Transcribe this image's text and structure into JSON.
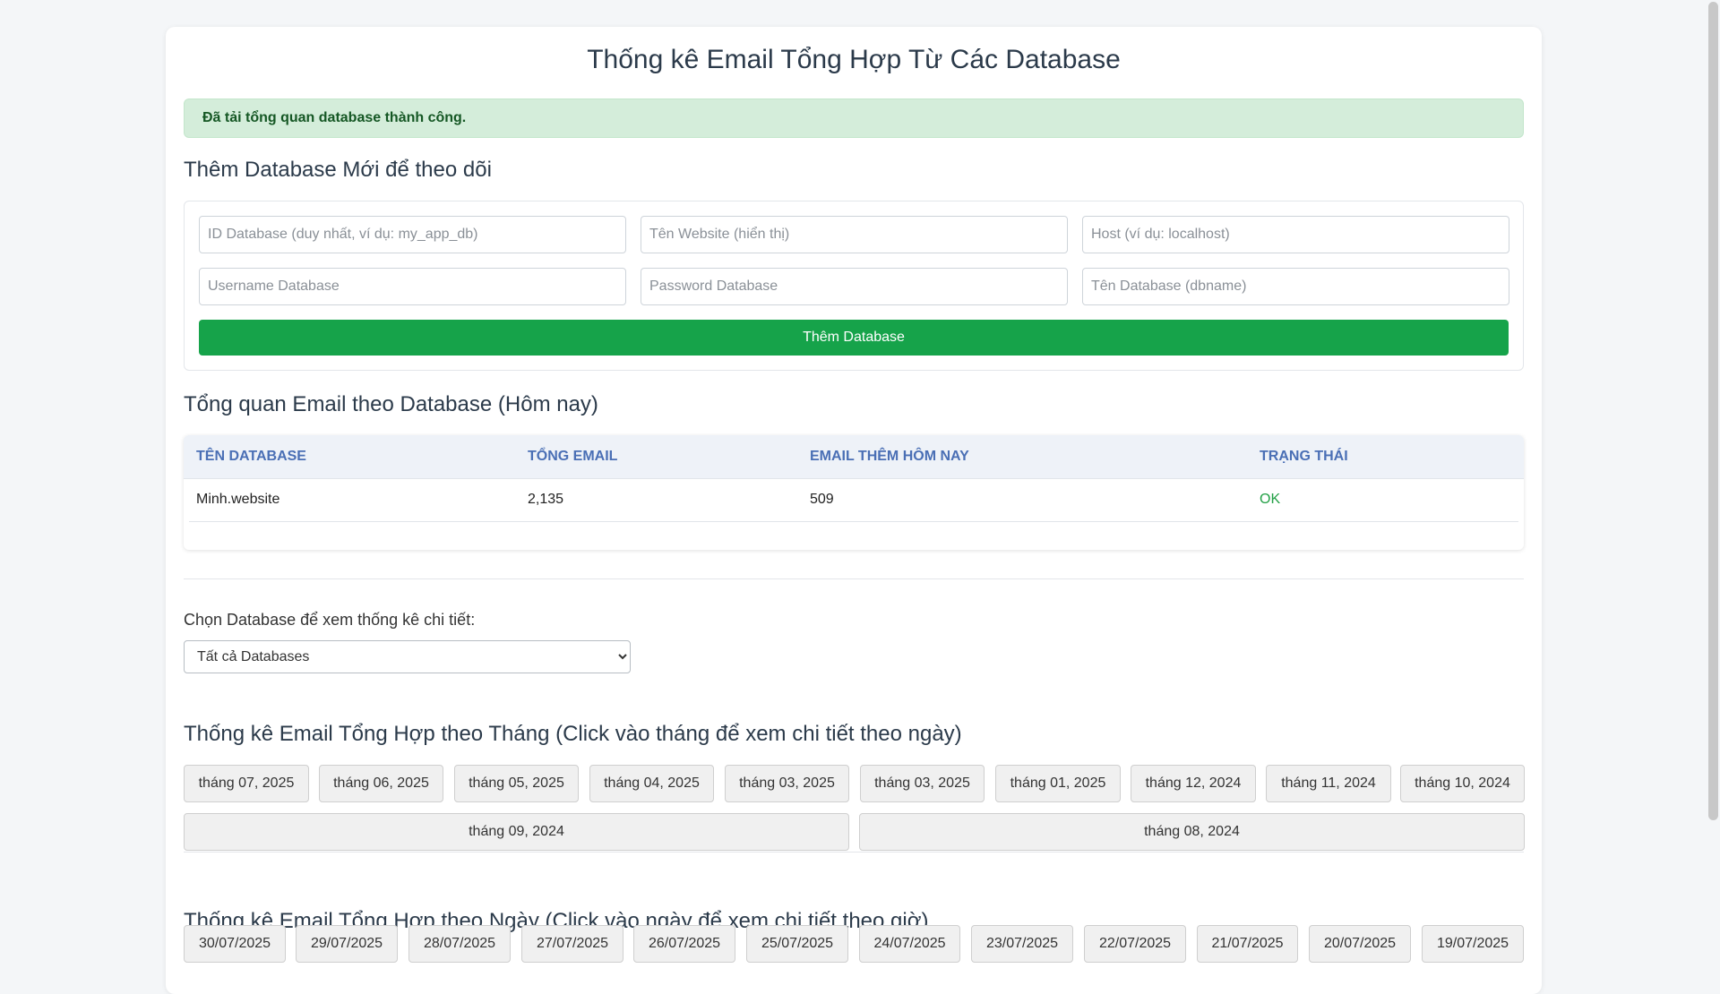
{
  "page": {
    "title": "Thống kê Email Tổng Hợp Từ Các Database"
  },
  "alert": {
    "message": "Đã tải tổng quan database thành công."
  },
  "add_form": {
    "heading": "Thêm Database Mới để theo dõi",
    "fields": [
      {
        "placeholder": "ID Database (duy nhất, ví dụ: my_app_db)",
        "value": ""
      },
      {
        "placeholder": "Tên Website (hiển thị)",
        "value": ""
      },
      {
        "placeholder": "Host (ví dụ: localhost)",
        "value": ""
      },
      {
        "placeholder": "Username Database",
        "value": ""
      },
      {
        "placeholder": "Password Database",
        "value": ""
      },
      {
        "placeholder": "Tên Database (dbname)",
        "value": ""
      }
    ],
    "submit_label": "Thêm Database"
  },
  "overview": {
    "heading": "Tổng quan Email theo Database (Hôm nay)",
    "columns": [
      "TÊN DATABASE",
      "TỔNG EMAIL",
      "EMAIL THÊM HÔM NAY",
      "TRẠNG THÁI"
    ],
    "rows": [
      {
        "name": "Minh.website",
        "total": "2,135",
        "today": "509",
        "status": "OK"
      }
    ],
    "status_color": "#22a045"
  },
  "selector": {
    "label": "Chọn Database để xem thống kê chi tiết:",
    "selected": "Tất cả Databases"
  },
  "monthly": {
    "heading": "Thống kê Email Tổng Hợp theo Tháng (Click vào tháng để xem chi tiết theo ngày)",
    "months": [
      "tháng 07, 2025",
      "tháng 06, 2025",
      "tháng 05, 2025",
      "tháng 04, 2025",
      "tháng 03, 2025",
      "tháng 03, 2025",
      "tháng 01, 2025",
      "tháng 12, 2024",
      "tháng 11, 2024",
      "tháng 10, 2024",
      "tháng 09, 2024",
      "tháng 08, 2024"
    ]
  },
  "daily": {
    "heading": "Thống kê Email Tổng Hợp theo Ngày (Click vào ngày để xem chi tiết theo giờ)",
    "days": [
      "30/07/2025",
      "29/07/2025",
      "28/07/2025",
      "27/07/2025",
      "26/07/2025",
      "25/07/2025",
      "24/07/2025",
      "23/07/2025",
      "22/07/2025",
      "21/07/2025",
      "20/07/2025",
      "19/07/2025"
    ]
  },
  "colors": {
    "primary_button": "#16a34a",
    "alert_bg": "#d4edda",
    "alert_text": "#155724",
    "table_header_text": "#4a6fb5"
  }
}
